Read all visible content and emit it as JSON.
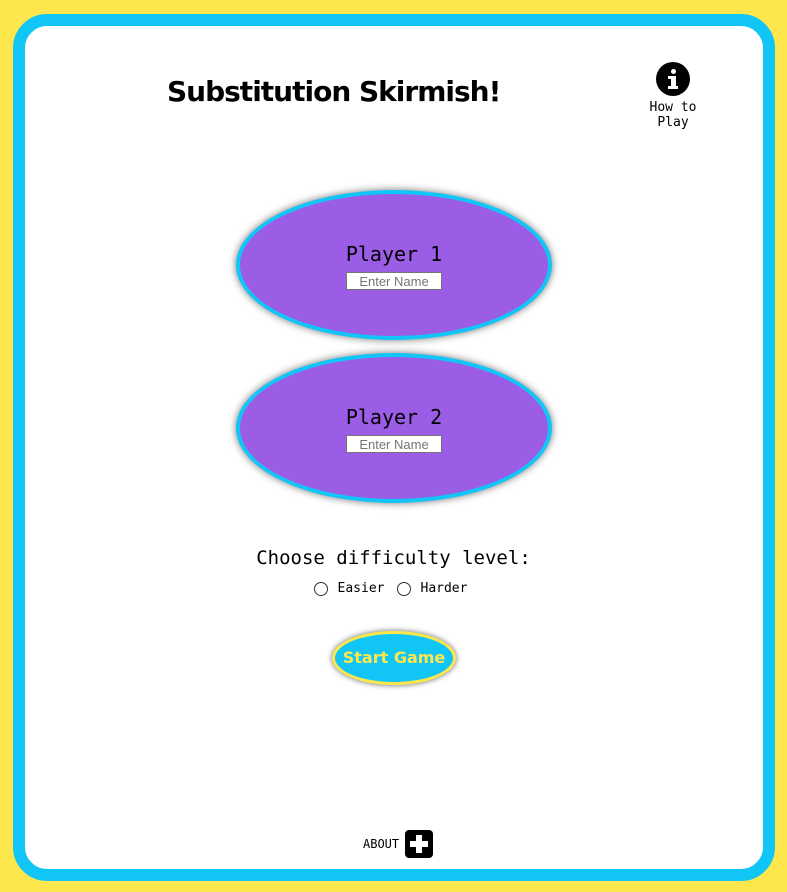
{
  "header": {
    "title": "Substitution Skirmish!",
    "how_to_play_label": "How to Play",
    "how_to_play_icon": "info-circle-icon"
  },
  "players": [
    {
      "label": "Player 1",
      "name_value": "",
      "name_placeholder": "Enter Name"
    },
    {
      "label": "Player 2",
      "name_value": "",
      "name_placeholder": "Enter Name"
    }
  ],
  "difficulty": {
    "label": "Choose difficulty level:",
    "options": [
      "Easier",
      "Harder"
    ],
    "selected": ""
  },
  "actions": {
    "start_label": "Start Game"
  },
  "footer": {
    "about_label": "ABOUT",
    "about_icon": "plus-square-icon"
  },
  "colors": {
    "background": "#fde74c",
    "frame_border": "#12c5f7",
    "player_fill": "#9b5de5",
    "button_text": "#fde74c"
  }
}
